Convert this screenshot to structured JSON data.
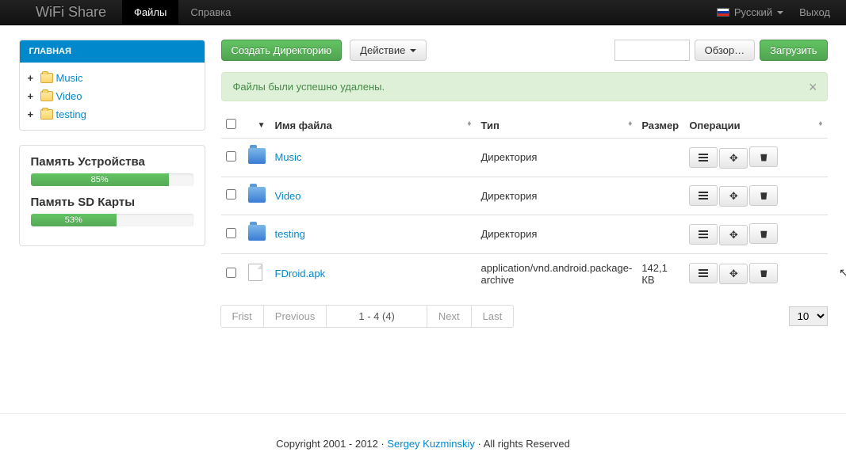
{
  "nav": {
    "brand": "WiFi Share",
    "tab_files": "Файлы",
    "tab_help": "Справка",
    "language": "Русский",
    "logout": "Выход"
  },
  "sidebar": {
    "header": "ГЛАВНАЯ",
    "tree": [
      {
        "label": "Music"
      },
      {
        "label": "Video"
      },
      {
        "label": "testing"
      }
    ],
    "memory_device_label": "Память Устройства",
    "memory_device_percent": "85%",
    "memory_device_value": 85,
    "memory_sd_label": "Память SD Карты",
    "memory_sd_percent": "53%",
    "memory_sd_value": 53
  },
  "toolbar": {
    "create_dir": "Создать Директорию",
    "action": "Действие",
    "browse": "Обзор…",
    "upload": "Загрузить"
  },
  "alert": {
    "message": "Файлы были успешно удалены."
  },
  "table": {
    "col_name": "Имя файла",
    "col_type": "Тип",
    "col_size": "Размер",
    "col_ops": "Операции",
    "rows": [
      {
        "name": "Music",
        "type": "Директория",
        "size": "",
        "kind": "folder"
      },
      {
        "name": "Video",
        "type": "Директория",
        "size": "",
        "kind": "folder"
      },
      {
        "name": "testing",
        "type": "Директория",
        "size": "",
        "kind": "folder"
      },
      {
        "name": "FDroid.apk",
        "type": "application/vnd.android.package-archive",
        "size": "142,1 КВ",
        "kind": "file"
      }
    ]
  },
  "pagination": {
    "first": "Frist",
    "previous": "Previous",
    "info": "1 - 4 (4)",
    "next": "Next",
    "last": "Last",
    "page_size": "10"
  },
  "footer": {
    "prefix": "Copyright 2001 - 2012 · ",
    "author": "Sergey Kuzminskiy",
    "suffix": " · All rights Reserved"
  }
}
